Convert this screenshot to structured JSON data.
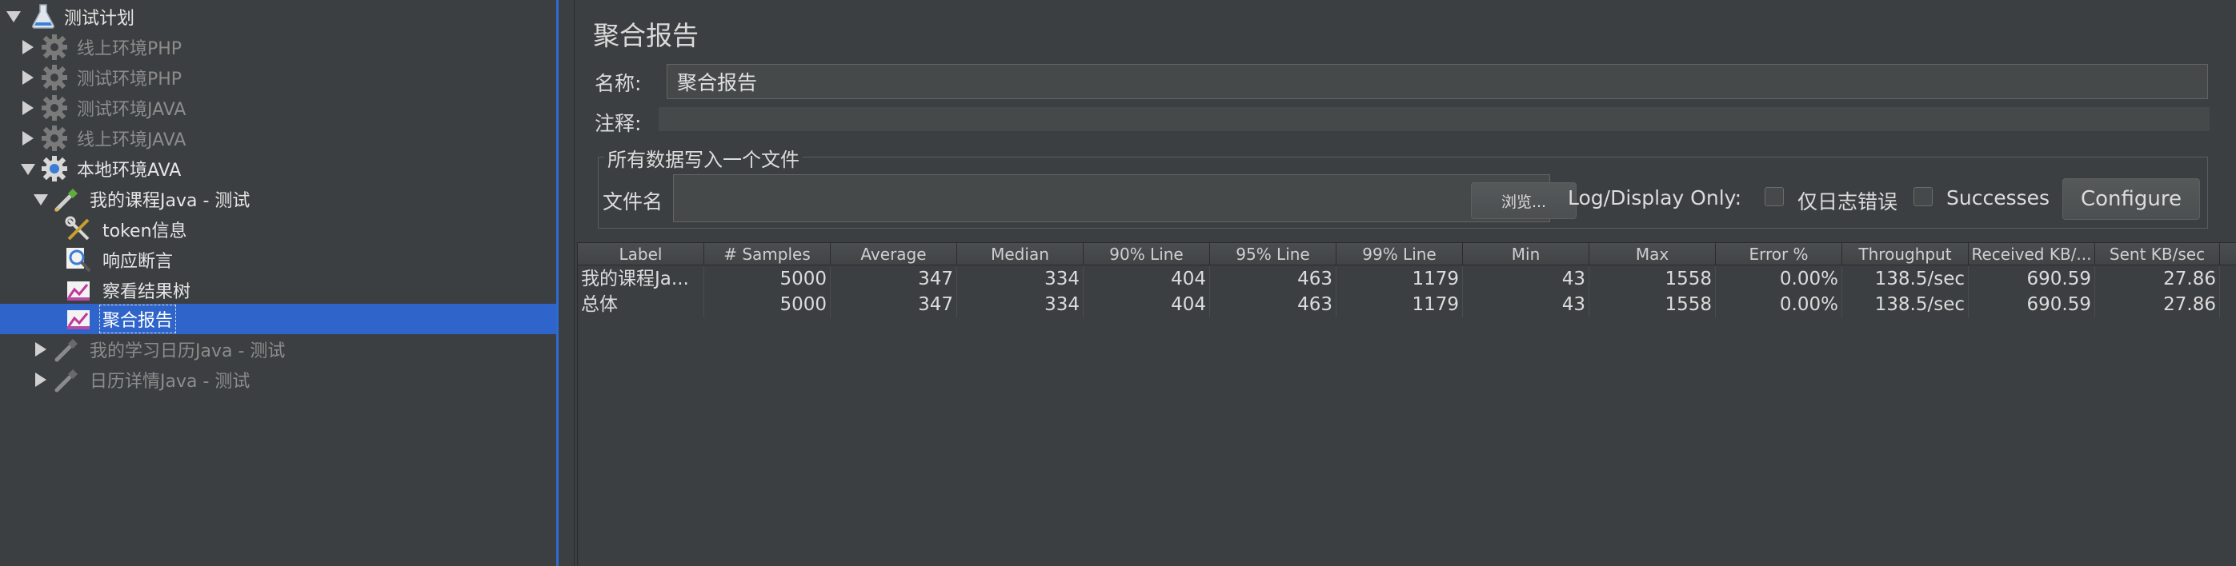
{
  "tree": {
    "items": [
      {
        "label": "测试计划",
        "icon": "flask-icon",
        "expanded": true
      },
      {
        "label": "线上环境PHP",
        "icon": "gear-icon",
        "expanded": false
      },
      {
        "label": "测试环境PHP",
        "icon": "gear-icon",
        "expanded": false
      },
      {
        "label": "测试环境JAVA",
        "icon": "gear-icon",
        "expanded": false
      },
      {
        "label": "线上环境JAVA",
        "icon": "gear-icon",
        "expanded": false
      },
      {
        "label": "本地环境AVA",
        "icon": "gear-icon",
        "expanded": true
      },
      {
        "label": "我的课程Java - 测试",
        "icon": "sampler-dropper-icon",
        "expanded": true
      },
      {
        "label": "token信息",
        "icon": "wrench-screwdriver-icon"
      },
      {
        "label": "响应断言",
        "icon": "magnifier-icon"
      },
      {
        "label": "察看结果树",
        "icon": "listener-graph-icon"
      },
      {
        "label": "聚合报告",
        "icon": "listener-graph-icon",
        "selected": true
      },
      {
        "label": "我的学习日历Java - 测试",
        "icon": "sampler-dropper-icon",
        "expanded": false
      },
      {
        "label": "日历详情Java - 测试",
        "icon": "sampler-dropper-icon",
        "expanded": false
      }
    ]
  },
  "panel": {
    "title": "聚合报告",
    "name_label": "名称:",
    "name_value": "聚合报告",
    "comment_label": "注释:",
    "file_group_legend": "所有数据写入一个文件",
    "filename_label": "文件名",
    "browse_label": "浏览...",
    "log_display_label": "Log/Display Only:",
    "errors_only_label": "仅日志错误",
    "successes_label": "Successes",
    "configure_label": "Configure"
  },
  "table": {
    "columns": [
      "Label",
      "# Samples",
      "Average",
      "Median",
      "90% Line",
      "95% Line",
      "99% Line",
      "Min",
      "Max",
      "Error %",
      "Throughput",
      "Received KB/...",
      "Sent KB/sec"
    ],
    "rows": [
      [
        "我的课程Ja...",
        "5000",
        "347",
        "334",
        "404",
        "463",
        "1179",
        "43",
        "1558",
        "0.00%",
        "138.5/sec",
        "690.59",
        "27.86"
      ],
      [
        "总体",
        "5000",
        "347",
        "334",
        "404",
        "463",
        "1179",
        "43",
        "1558",
        "0.00%",
        "138.5/sec",
        "690.59",
        "27.86"
      ]
    ]
  },
  "colors": {
    "background": "#3c3f41",
    "selection": "#2f65ca",
    "splitter_accent": "#2d6bd1"
  }
}
